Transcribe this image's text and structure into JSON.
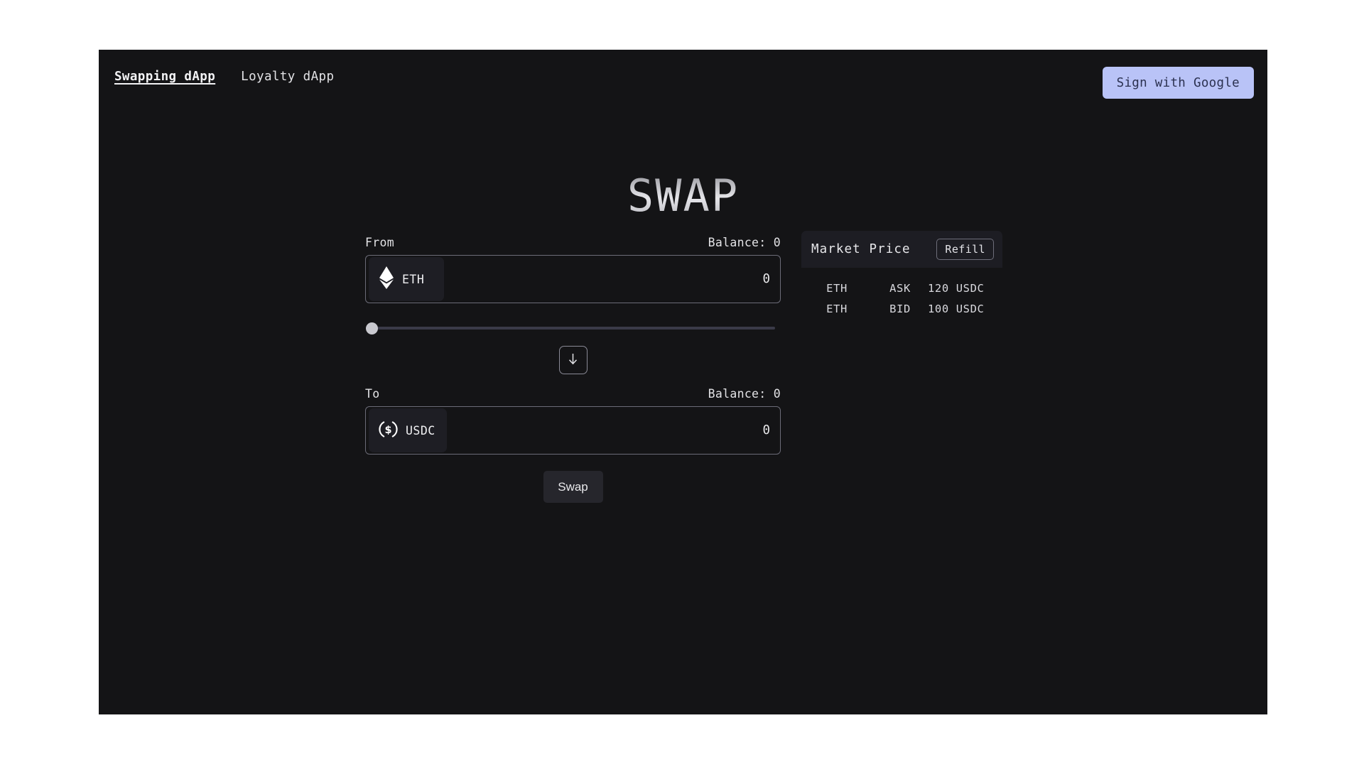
{
  "nav": {
    "links": [
      {
        "label": "Swapping dApp",
        "active": true
      },
      {
        "label": "Loyalty dApp",
        "active": false
      }
    ],
    "sign_in_label": "Sign with Google"
  },
  "page": {
    "title": "SWAP"
  },
  "swap": {
    "from": {
      "label": "From",
      "balance_label": "Balance: 0",
      "token_symbol": "ETH",
      "token_icon": "ethereum-icon",
      "amount": "0",
      "amount_placeholder": "0"
    },
    "slider": {
      "value": "0",
      "min": "0",
      "max": "100"
    },
    "direction_icon": "arrow-down-icon",
    "to": {
      "label": "To",
      "balance_label": "Balance: 0",
      "token_symbol": "USDC",
      "token_icon": "usdc-icon",
      "amount": "0",
      "amount_placeholder": "0"
    },
    "submit_label": "Swap"
  },
  "market": {
    "title": "Market Price",
    "refill_label": "Refill",
    "rows": [
      {
        "pair": "ETH",
        "side": "ASK",
        "price": "120 USDC"
      },
      {
        "pair": "ETH",
        "side": "BID",
        "price": "100 USDC"
      }
    ]
  },
  "colors": {
    "page_background": "#ffffff",
    "app_background": "#141416",
    "accent_button": "#b9c3f7",
    "accent_button_text": "#2b3150",
    "panel_background": "#1d1d23",
    "chip_background": "#1e1e24",
    "border": "#6c6c78",
    "text_primary": "#e7e7ea"
  }
}
